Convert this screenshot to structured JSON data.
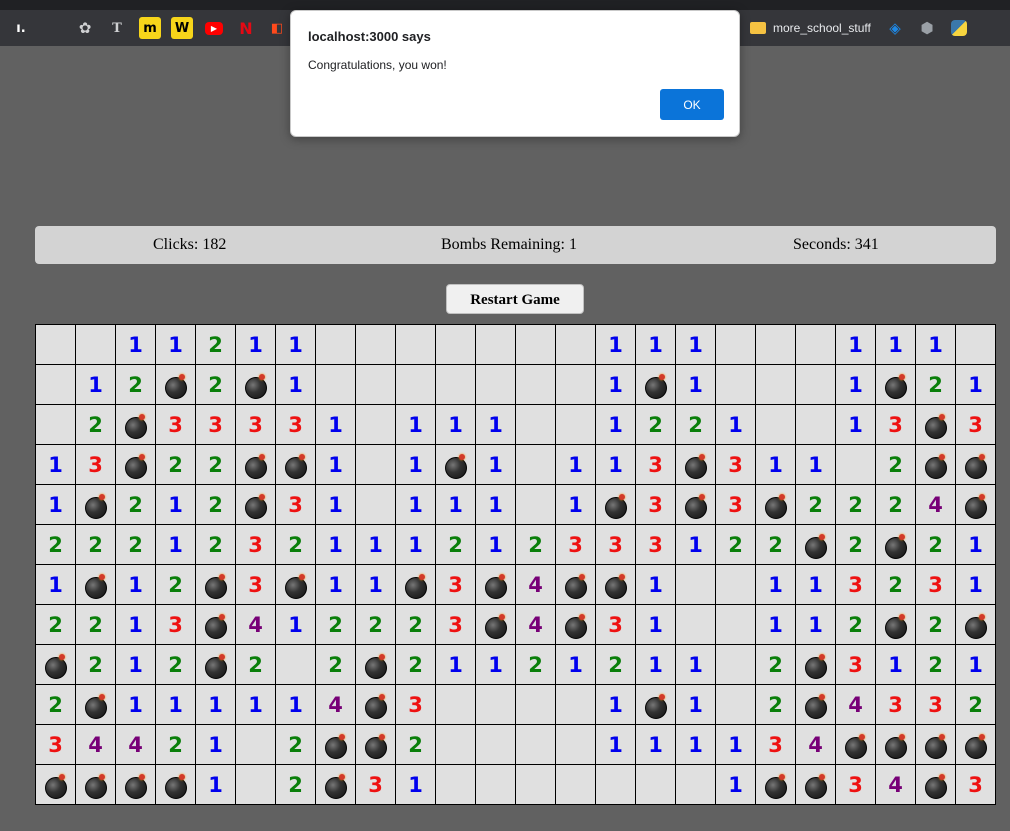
{
  "browser": {
    "bookmark_folder_label": "more_school_stuff"
  },
  "dialog": {
    "origin": "localhost:3000 says",
    "message": "Congratulations, you won!",
    "ok_label": "OK"
  },
  "status": {
    "clicks": "Clicks: 182",
    "bombs": "Bombs Remaining: 1",
    "seconds": "Seconds: 341"
  },
  "restart_label": "Restart Game",
  "board": [
    [
      "",
      "",
      "1",
      "1",
      "2",
      "1",
      "1",
      "",
      "",
      "",
      "",
      "",
      "",
      "",
      "1",
      "1",
      "1",
      "",
      "",
      "",
      "1",
      "1",
      "1",
      ""
    ],
    [
      "",
      "1",
      "2",
      "B",
      "2",
      "B",
      "1",
      "",
      "",
      "",
      "",
      "",
      "",
      "",
      "1",
      "B",
      "1",
      "",
      "",
      "",
      "1",
      "B",
      "2",
      "1"
    ],
    [
      "",
      "2",
      "B",
      "3",
      "3",
      "3",
      "3",
      "1",
      "",
      "1",
      "1",
      "1",
      "",
      "",
      "1",
      "2",
      "2",
      "1",
      "",
      "",
      "1",
      "3",
      "B",
      "3"
    ],
    [
      "1",
      "3",
      "B",
      "2",
      "2",
      "B",
      "B",
      "1",
      "",
      "1",
      "B",
      "1",
      "",
      "1",
      "1",
      "3",
      "B",
      "3",
      "1",
      "1",
      "",
      "2",
      "B",
      "B"
    ],
    [
      "1",
      "B",
      "2",
      "1",
      "2",
      "B",
      "3",
      "1",
      "",
      "1",
      "1",
      "1",
      "",
      "1",
      "B",
      "3",
      "B",
      "3",
      "B",
      "2",
      "2",
      "2",
      "4",
      "B"
    ],
    [
      "2",
      "2",
      "2",
      "1",
      "2",
      "3",
      "2",
      "1",
      "1",
      "1",
      "2",
      "1",
      "2",
      "3",
      "3",
      "3",
      "1",
      "2",
      "2",
      "B",
      "2",
      "B",
      "2",
      "1"
    ],
    [
      "1",
      "B",
      "1",
      "2",
      "B",
      "3",
      "B",
      "1",
      "1",
      "B",
      "3",
      "B",
      "4",
      "B",
      "B",
      "1",
      "",
      "",
      "1",
      "1",
      "3",
      "2",
      "3",
      "1"
    ],
    [
      "2",
      "2",
      "1",
      "3",
      "B",
      "4",
      "1",
      "2",
      "2",
      "2",
      "3",
      "B",
      "4",
      "B",
      "3",
      "1",
      "",
      "",
      "1",
      "1",
      "2",
      "B",
      "2",
      "B"
    ],
    [
      "B",
      "2",
      "1",
      "2",
      "B",
      "2",
      "",
      "2",
      "B",
      "2",
      "1",
      "1",
      "2",
      "1",
      "2",
      "1",
      "1",
      "",
      "2",
      "B",
      "3",
      "1",
      "2",
      "1"
    ],
    [
      "2",
      "B",
      "1",
      "1",
      "1",
      "1",
      "1",
      "4",
      "B",
      "3",
      "",
      "",
      "",
      "",
      "1",
      "B",
      "1",
      "",
      "2",
      "B",
      "4",
      "3",
      "3",
      "2"
    ],
    [
      "3",
      "4",
      "4",
      "2",
      "1",
      "",
      "2",
      "B",
      "B",
      "2",
      "",
      "",
      "",
      "",
      "1",
      "1",
      "1",
      "1",
      "3",
      "4",
      "B",
      "B",
      "B",
      "B"
    ],
    [
      "B",
      "B",
      "B",
      "B",
      "1",
      "",
      "2",
      "B",
      "3",
      "1",
      "",
      "",
      "",
      "",
      "",
      "",
      "",
      "1",
      "B",
      "B",
      "3",
      "4",
      "B",
      "3"
    ]
  ]
}
